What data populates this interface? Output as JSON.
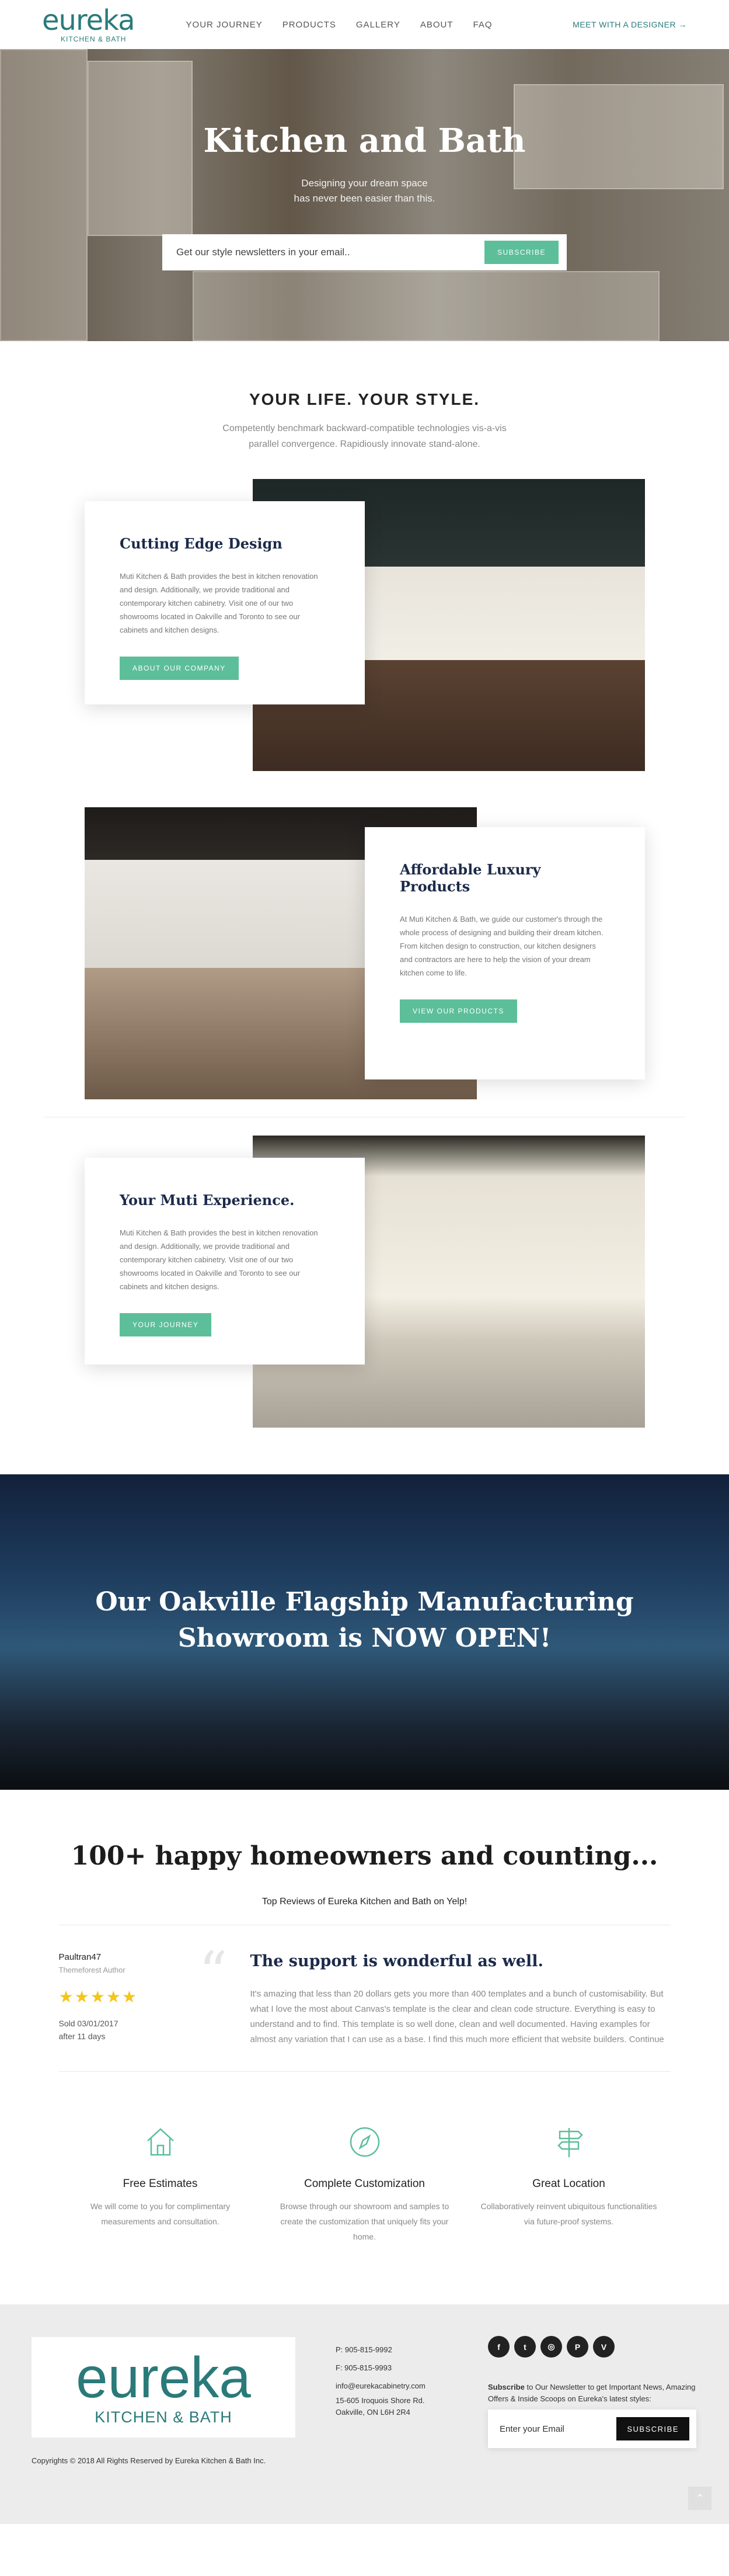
{
  "header": {
    "logo_word": "eureka",
    "logo_sub": "KITCHEN & BATH",
    "nav": [
      "YOUR JOURNEY",
      "PRODUCTS",
      "GALLERY",
      "ABOUT",
      "FAQ"
    ],
    "cta": "MEET WITH A DESIGNER →"
  },
  "hero": {
    "title": "Kitchen and Bath",
    "subtitle_line1": "Designing your dream space",
    "subtitle_line2": "has never been easier than this.",
    "input_placeholder": "Get our style newsletters in your email..",
    "button": "SUBSCRIBE"
  },
  "intro": {
    "heading": "YOUR LIFE. YOUR STYLE.",
    "text_line1": "Competently benchmark backward-compatible technologies vis-a-vis",
    "text_line2": "parallel convergence. Rapidiously innovate stand-alone."
  },
  "features": [
    {
      "title": "Cutting Edge Design",
      "text": "Muti Kitchen & Bath provides the best in kitchen renovation and design. Additionally, we provide traditional and contemporary kitchen cabinetry. Visit one of our two showrooms located in Oakville and Toronto to see our cabinets and kitchen designs.",
      "button": "ABOUT OUR COMPANY"
    },
    {
      "title": "Affordable Luxury Products",
      "text": "At Muti Kitchen & Bath, we guide our customer's through the whole process of designing and building their dream kitchen. From kitchen design to construction, our kitchen designers and contractors are here to help the vision of your dream kitchen come to life.",
      "button": "VIEW OUR PRODUCTS"
    },
    {
      "title": "Your Muti Experience.",
      "text": "Muti Kitchen & Bath provides the best in kitchen renovation and design. Additionally, we provide traditional and contemporary kitchen cabinetry. Visit one of our two showrooms located in Oakville and Toronto to see our cabinets and kitchen designs.",
      "button": "YOUR JOURNEY"
    }
  ],
  "banner": {
    "line1": "Our Oakville Flagship Manufacturing",
    "line2": "Showroom is NOW OPEN!"
  },
  "reviews": {
    "heading": "100+ happy homeowners and counting...",
    "subheading": "Top Reviews of Eureka Kitchen and Bath on Yelp!",
    "reviewer_name": "Paultran47",
    "reviewer_role": "Themeforest Author",
    "stars": "★★★★★",
    "rating": 5,
    "sold_line1": "Sold 03/01/2017",
    "sold_line2": "after 11 days",
    "title": "The support is wonderful as well.",
    "body": "It's amazing that less than 20 dollars gets you more than 400 templates and a bunch of customisability. But what I love the most about Canvas's template is the clear and clean code structure. Everything is easy to understand and to find. This template is so well done, clean and well documented. Having examples for almost any variation that I can use as a base. I find this much more efficient that website builders. Continue"
  },
  "services": [
    {
      "icon": "home-icon",
      "title": "Free Estimates",
      "text": "We will come to you for complimentary measurements and consultation."
    },
    {
      "icon": "compass-icon",
      "title": "Complete Customization",
      "text": "Browse through our showroom and samples to create the customization that uniquely fits your home."
    },
    {
      "icon": "signpost-icon",
      "title": "Great Location",
      "text": "Collaboratively reinvent ubiquitous functionalities via future-proof systems."
    }
  ],
  "footer": {
    "logo_word": "eureka",
    "logo_sub": "KITCHEN & BATH",
    "phone": "P: 905-815-9992",
    "fax": "F: 905-815-9993",
    "email": "info@eurekacabinetry.com",
    "address_line1": "15-605 Iroquois Shore Rd.",
    "address_line2": "Oakville, ON L6H 2R4",
    "copyright": "Copyrights © 2018 All Rights Reserved by Eureka Kitchen & Bath Inc.",
    "social": [
      "f",
      "t",
      "◎",
      "P",
      "V"
    ],
    "newsletter_bold": "Subscribe",
    "newsletter_text": " to Our Newsletter to get Important News, Amazing Offers & Inside Scoops on Eureka's latest styles:",
    "input_placeholder": "Enter your Email",
    "button": "SUBSCRIBE",
    "to_top": "⌃"
  }
}
